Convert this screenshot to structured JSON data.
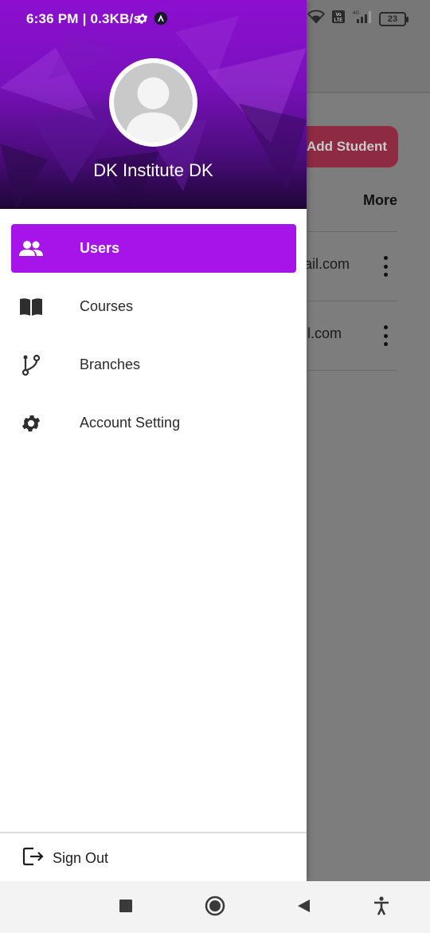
{
  "status_bar": {
    "time_speed": "6:36 PM | 0.3KB/s",
    "network_badge": "4G",
    "volte_badge": "Vo LTE",
    "battery": "23",
    "icons": [
      "settings-icon",
      "vpn-icon",
      "wifi-icon",
      "signal-icon",
      "battery-icon"
    ]
  },
  "background_app": {
    "add_button_label": "Add Student",
    "column_header": "More",
    "rows": [
      {
        "email": "ail.com"
      },
      {
        "email": "il.com"
      }
    ],
    "colors": {
      "add_button": "#e0405f",
      "scrim": "#7d7d7d"
    }
  },
  "drawer": {
    "profile_name": "DK Institute DK",
    "header_color": "#8c0fd0",
    "active_color": "#a614ea",
    "menu": [
      {
        "label": "Users",
        "icon": "users-icon",
        "active": true
      },
      {
        "label": "Courses",
        "icon": "book-icon",
        "active": false
      },
      {
        "label": "Branches",
        "icon": "branch-icon",
        "active": false
      },
      {
        "label": "Account Setting",
        "icon": "gear-icon",
        "active": false
      }
    ],
    "sign_out_label": "Sign Out"
  },
  "nav_bar": {
    "buttons": [
      "recents-button",
      "home-button",
      "back-button",
      "accessibility-button"
    ]
  }
}
